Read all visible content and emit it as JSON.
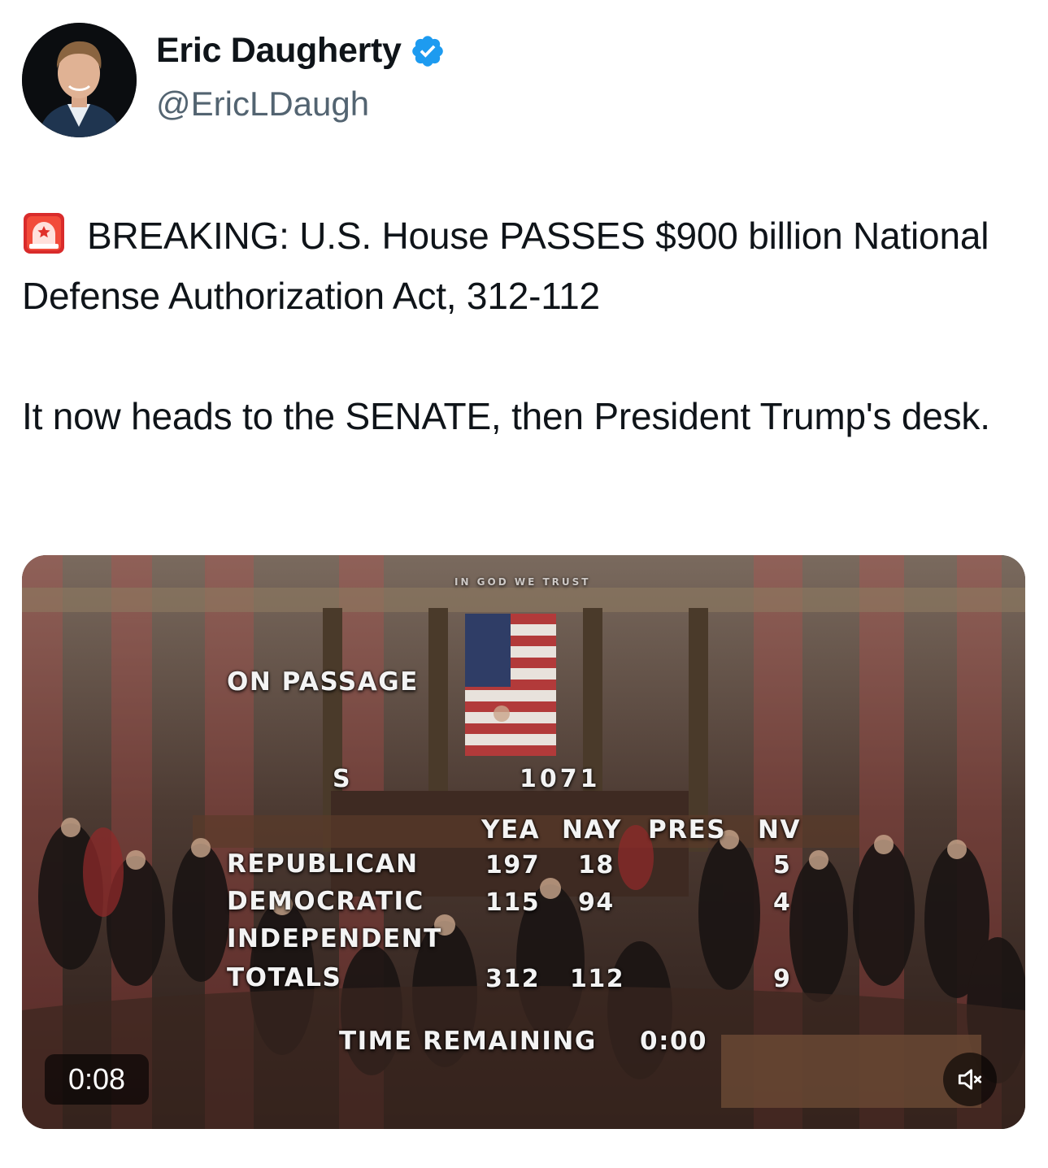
{
  "author": {
    "name": "Eric Daugherty",
    "handle": "@EricLDaugh",
    "verified": true,
    "verified_color": "#1d9bf0"
  },
  "tweet": {
    "emoji_icon": "rotating-light-siren",
    "paragraphs": [
      "BREAKING: U.S. House PASSES $900 billion National Defense Authorization Act, 312-112",
      "It now heads to the SENATE, then President Trump's desk."
    ]
  },
  "video": {
    "duration": "0:08",
    "muted": true,
    "scene_text": {
      "motto": "IN GOD WE TRUST",
      "on_passage": "ON PASSAGE",
      "bill_prefix": "S",
      "bill_number": "1071",
      "headers": {
        "yea": "YEA",
        "nay": "NAY",
        "pres": "PRES",
        "nv": "NV"
      },
      "rows": [
        {
          "party": "REPUBLICAN",
          "yea": "197",
          "nay": "18",
          "pres": "",
          "nv": "5"
        },
        {
          "party": "DEMOCRATIC",
          "yea": "115",
          "nay": "94",
          "pres": "",
          "nv": "4"
        },
        {
          "party": "INDEPENDENT",
          "yea": "",
          "nay": "",
          "pres": "",
          "nv": ""
        },
        {
          "party": "TOTALS",
          "yea": "312",
          "nay": "112",
          "pres": "",
          "nv": "9"
        }
      ],
      "time_remaining_label": "TIME REMAINING",
      "time_remaining_value": "0:00"
    }
  }
}
